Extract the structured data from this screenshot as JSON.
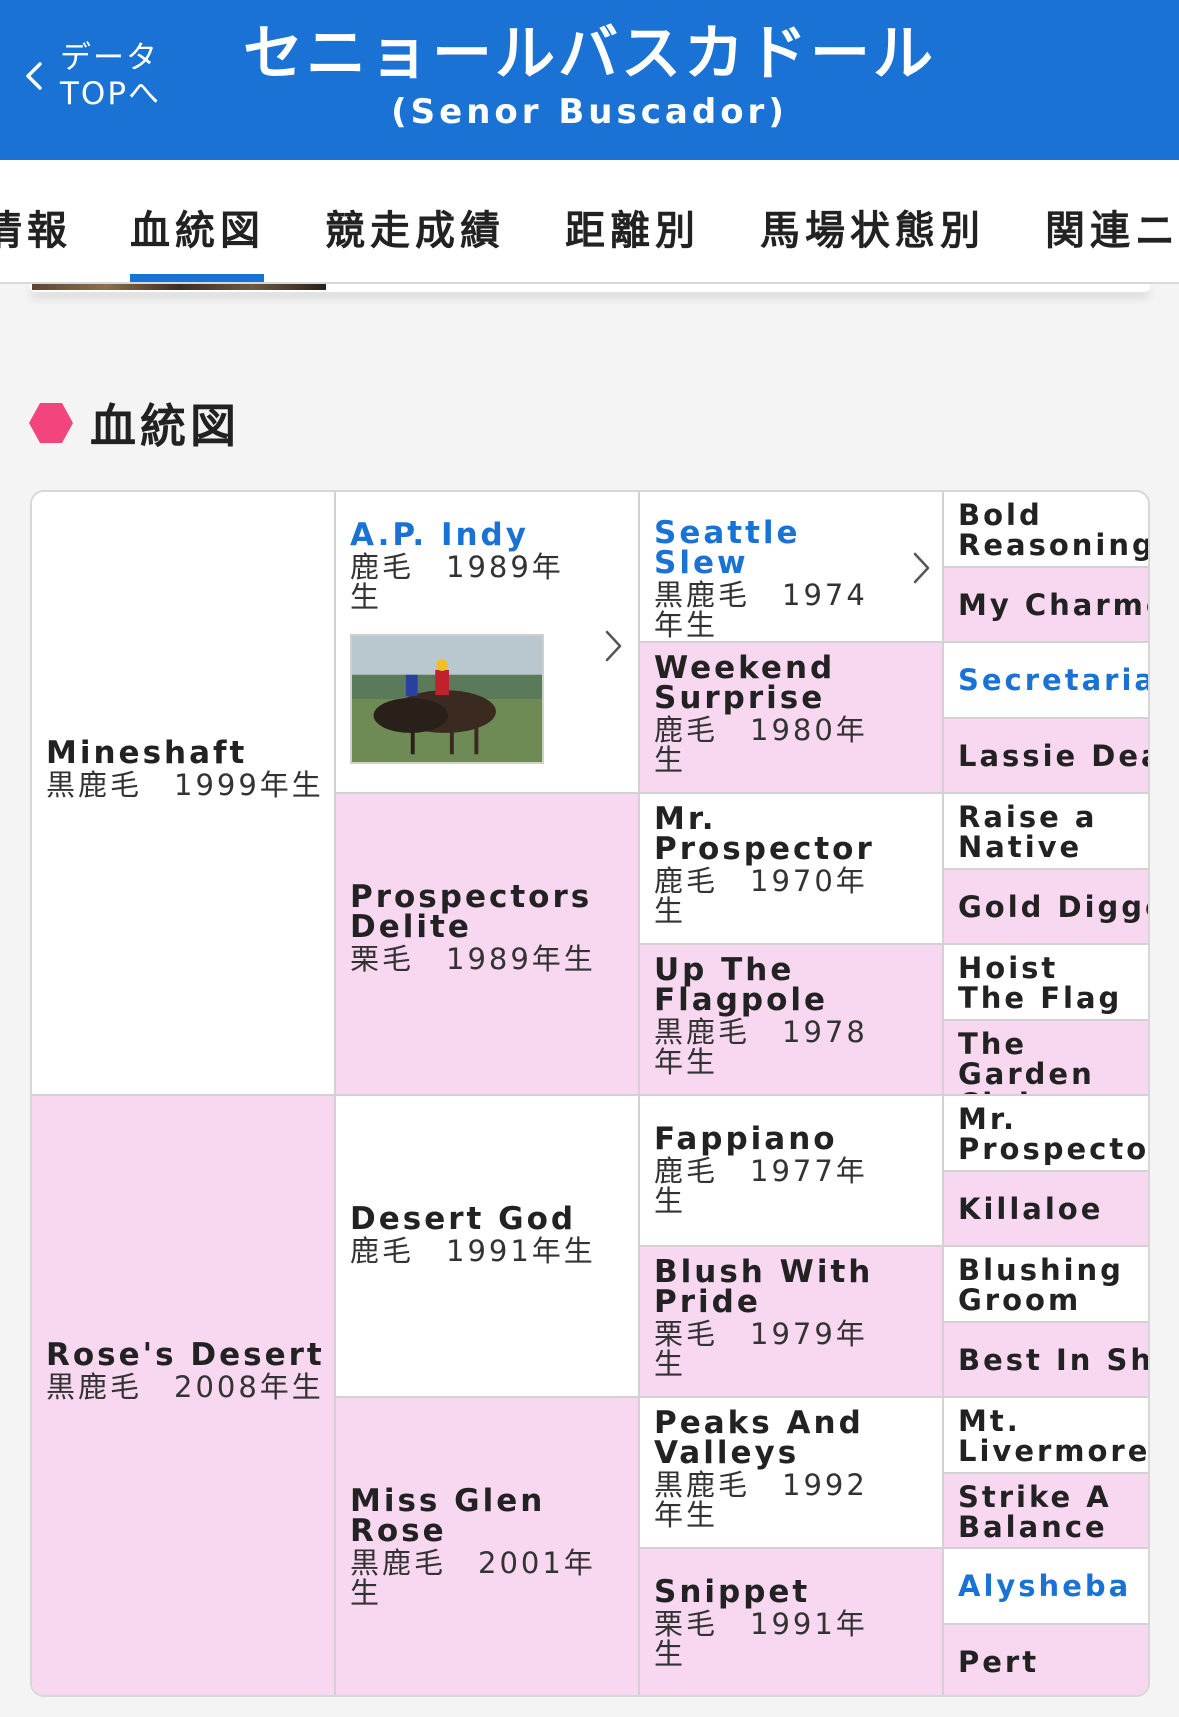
{
  "header": {
    "back_label_line1": "データ",
    "back_label_line2": "TOPへ",
    "title": "セニョールバスカドール",
    "subtitle": "(Senor Buscador)"
  },
  "tabs": [
    "情報",
    "血統図",
    "競走成績",
    "距離別",
    "馬場状態別",
    "関連ニ"
  ],
  "active_tab": "血統図",
  "section": {
    "title": "血統図"
  },
  "colors": {
    "header_blue": "#1a73d4",
    "pink_cell": "#f8d7f0",
    "section_icon": "#f2457e",
    "link": "#1a73d4"
  },
  "pedigree": {
    "gen1": [
      {
        "name": "Mineshaft",
        "info": "黒鹿毛　1999年生"
      },
      {
        "name": "Rose's Desert",
        "info": "黒鹿毛　2008年生"
      }
    ],
    "gen2": [
      {
        "name": "A.P. Indy",
        "info": "鹿毛　1989年生"
      },
      {
        "name": "Prospectors Delite",
        "info": "栗毛　1989年生"
      },
      {
        "name": "Desert God",
        "info": "鹿毛　1991年生"
      },
      {
        "name": "Miss Glen Rose",
        "info": "黒鹿毛　2001年生"
      }
    ],
    "gen3": [
      {
        "name": "Seattle Slew",
        "info": "黒鹿毛　1974年生"
      },
      {
        "name": "Weekend Surprise",
        "info": "鹿毛　1980年生"
      },
      {
        "name": "Mr. Prospector",
        "info": "鹿毛　1970年生"
      },
      {
        "name": "Up The Flagpole",
        "info": "黒鹿毛　1978年生"
      },
      {
        "name": "Fappiano",
        "info": "鹿毛　1977年生"
      },
      {
        "name": "Blush With Pride",
        "info": "栗毛　1979年生"
      },
      {
        "name": "Peaks And Valleys",
        "info": "黒鹿毛　1992年生"
      },
      {
        "name": "Snippet",
        "info": "栗毛　1991年生"
      }
    ],
    "gen4": [
      "Bold Reasoning",
      "My Charmer",
      "Secretariat",
      "Lassie Dear",
      "Raise a Native",
      "Gold Digger",
      "Hoist The Flag",
      "The Garden Club",
      "Mr. Prospector",
      "Killaloe",
      "Blushing Groom",
      "Best In Show",
      "Mt. Livermore",
      "Strike A Balance",
      "Alysheba",
      "Pert"
    ]
  }
}
